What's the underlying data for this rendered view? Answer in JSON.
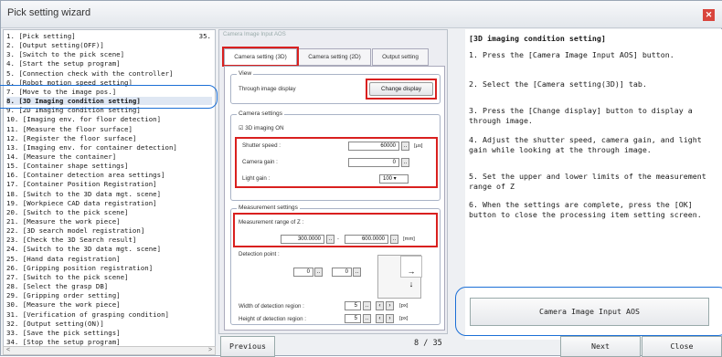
{
  "window": {
    "title": "Pick setting wizard",
    "close_icon": "close-icon"
  },
  "left_list": {
    "page_label": "35.",
    "items": [
      "1. [Pick setting]",
      "2. [Output setting(OFF)]",
      "3. [Switch to the pick scene]",
      "4. [Start the setup program]",
      "5. [Connection check with the controller]",
      "6. [Robot motion speed setting]",
      "7. [Move to the image pos.]",
      "8. [3D Imaging condition setting]",
      "9. [2D Imaging condition setting]",
      "10. [Imaging env. for floor detection]",
      "11. [Measure the floor surface]",
      "12. [Register the floor surface]",
      "13. [Imaging env. for container detection]",
      "14. [Measure the container]",
      "15. [Container shape settings]",
      "16. [Container detection area settings]",
      "17. [Container Position Registration]",
      "18. [Switch to the 3D data mgt. scene]",
      "19. [Workpiece CAD data registration]",
      "20. [Switch to the pick scene]",
      "21. [Measure the work piece]",
      "22. [3D search model registration]",
      "23. [Check the 3D Search result]",
      "24. [Switch to the 3D data mgt. scene]",
      "25. [Hand data registration]",
      "26. [Gripping position registration]",
      "27. [Switch to the pick scene]",
      "28. [Select the grasp DB]",
      "29. [Gripping order setting]",
      "30. [Measure the work piece]",
      "31. [Verification of grasping condition]",
      "32. [Output setting(ON)]",
      "33. [Save the pick settings]",
      "34. [Stop the setup program]"
    ],
    "selected_index": 7
  },
  "panel": {
    "title": "Camera Image Input AOS",
    "tabs": [
      "Camera setting (3D)",
      "Camera setting (2D)",
      "Output setting"
    ],
    "view_group": "View",
    "through_image_label": "Through image display",
    "change_display_button": "Change display",
    "camera_group": "Camera settings",
    "imaging_on_label": "3D imaging ON",
    "shutter_label": "Shutter speed :",
    "shutter_value": "60000",
    "shutter_unit": "[μs]",
    "gain_label": "Camera gain :",
    "gain_value": "0",
    "light_label": "Light gain :",
    "light_value": "100",
    "measurement_group": "Measurement settings",
    "range_label": "Measurement range of Z :",
    "range_min": "300.0000",
    "range_sep": "-",
    "range_max": "600.0000",
    "range_unit": "[mm]",
    "detection_label": "Detection point :",
    "det_x": "0",
    "det_y": "0",
    "width_label": "Width of detection region :",
    "width_value": "5",
    "height_label": "Height of detection region :",
    "height_value": "5",
    "px_unit": "[px]"
  },
  "instructions": {
    "heading": "[3D imaging condition setting]",
    "steps": [
      "1. Press the [Camera Image Input AOS] button.",
      "2. Select the [Camera setting(3D)] tab.",
      "3. Press the [Change display] button to display a through image.",
      "4. Adjust the shutter speed, camera gain, and light gain while looking at the through image.",
      "5. Set the upper and lower limits of the measurement range of Z",
      "6. When the settings are complete, press the [OK] button to close the processing item setting screen."
    ]
  },
  "buttons": {
    "camera_image_input": "Camera Image Input AOS",
    "previous": "Previous",
    "next": "Next",
    "close": "Close"
  },
  "counter": "8 / 35",
  "colors": {
    "highlight_red": "#d9201f",
    "highlight_blue": "#1b6fd6"
  }
}
